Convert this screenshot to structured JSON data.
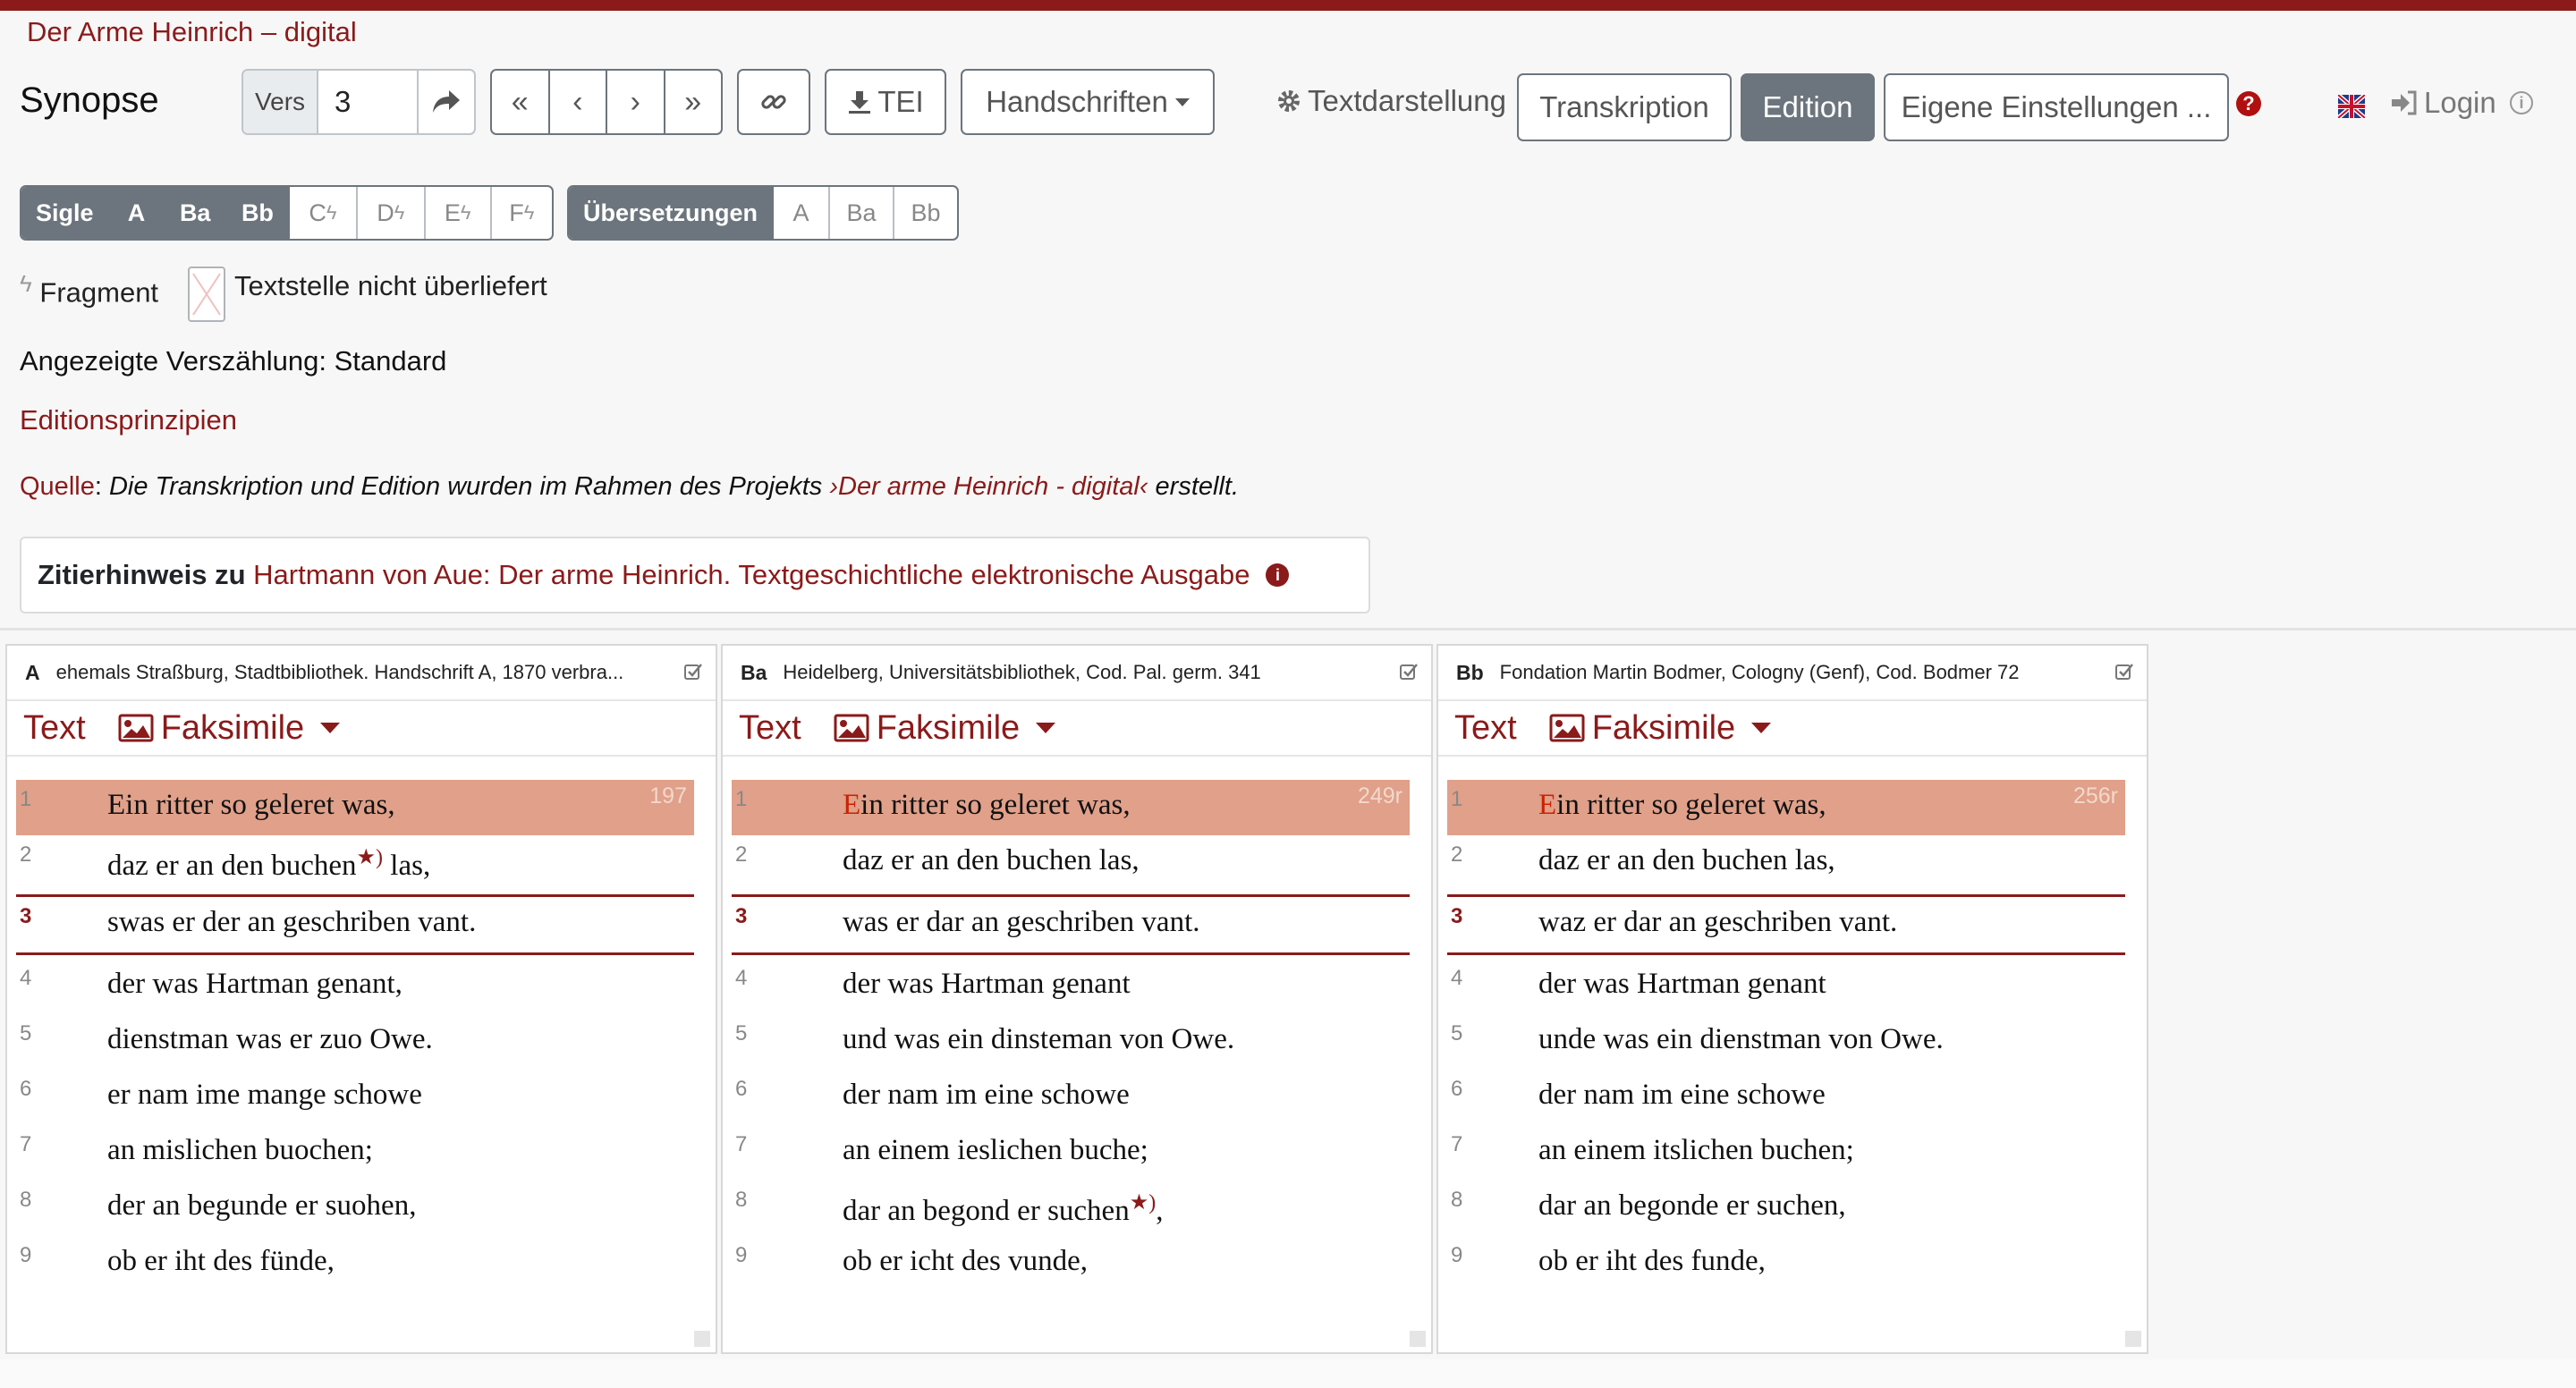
{
  "app": {
    "title": "Der Arme Heinrich – digital"
  },
  "toolbar": {
    "synopse": "Synopse",
    "vers_label": "Vers",
    "vers_value": "3",
    "nav": [
      "«",
      "‹",
      "›",
      "»"
    ],
    "tei": "TEI",
    "handschriften": "Handschriften",
    "textdarstellung": "Textdarstellung",
    "transkription": "Transkription",
    "edition": "Edition",
    "eigene": "Eigene Einstellungen ...",
    "login": "Login"
  },
  "sigle": {
    "label": "Sigle",
    "items": [
      "A",
      "Ba",
      "Bb",
      "C",
      "D",
      "E",
      "F"
    ],
    "uebersetzungen": "Übersetzungen",
    "u_items": [
      "A",
      "Ba",
      "Bb"
    ]
  },
  "legend": {
    "fragment": "Fragment",
    "missing": "Textstelle nicht überliefert"
  },
  "info": {
    "verszaehlung": "Angezeigte Verszählung: Standard",
    "editionsprinzipien": "Editionsprinzipien",
    "quelle_label": "Quelle",
    "quelle_pre": "Die Transkription und Edition wurden im Rahmen des Projekts ",
    "quelle_link": "›Der arme Heinrich - digital‹",
    "quelle_post": " erstellt.",
    "zitier_label": "Zitierhinweis zu ",
    "zitier_link": "Hartmann von Aue: Der arme Heinrich. Textgeschichtliche elektronische Ausgabe"
  },
  "panels": [
    {
      "sigle": "A",
      "title": "ehemals Straßburg, Stadtbibliothek. Handschrift A, 1870 verbra...",
      "tab_text": "Text",
      "tab_faksimile": "Faksimile",
      "folio": "197",
      "verses": [
        {
          "n": "1",
          "initial": "E",
          "rest": "in ritter so geleret was,"
        },
        {
          "n": "2",
          "initial": "",
          "rest": "daz er an den buchen",
          "star": "★)",
          "after": " las,"
        },
        {
          "n": "3",
          "initial": "",
          "rest": "swas er der an geschriben vant."
        },
        {
          "n": "4",
          "initial": "",
          "rest": "der was Hartman genant,"
        },
        {
          "n": "5",
          "initial": "",
          "rest": "dienstman was er zuo Owe."
        },
        {
          "n": "6",
          "initial": "",
          "rest": "er nam ime mange schowe"
        },
        {
          "n": "7",
          "initial": "",
          "rest": "an mislichen buochen;"
        },
        {
          "n": "8",
          "initial": "",
          "rest": "der an begunde er suohen,"
        },
        {
          "n": "9",
          "initial": "",
          "rest": "ob er iht des fünde,"
        }
      ]
    },
    {
      "sigle": "Ba",
      "title": "Heidelberg, Universitätsbibliothek, Cod. Pal. germ. 341",
      "tab_text": "Text",
      "tab_faksimile": "Faksimile",
      "folio": "249r",
      "verses": [
        {
          "n": "1",
          "initial": "E",
          "rest": "in ritter so geleret was,"
        },
        {
          "n": "2",
          "initial": "",
          "rest": "daz er an den buchen las,"
        },
        {
          "n": "3",
          "initial": "",
          "rest": "was er dar an geschriben vant."
        },
        {
          "n": "4",
          "initial": "",
          "rest": "der was Hartman genant"
        },
        {
          "n": "5",
          "initial": "",
          "rest": "und was ein dinsteman von Owe."
        },
        {
          "n": "6",
          "initial": "",
          "rest": "der nam im eine schowe"
        },
        {
          "n": "7",
          "initial": "",
          "rest": "an einem ieslichen buche;"
        },
        {
          "n": "8",
          "initial": "",
          "rest": "dar an begond er suchen",
          "star": "★)",
          "after": ","
        },
        {
          "n": "9",
          "initial": "",
          "rest": "ob er icht des vunde,"
        }
      ]
    },
    {
      "sigle": "Bb",
      "title": "Fondation Martin Bodmer, Cologny (Genf), Cod. Bodmer 72",
      "tab_text": "Text",
      "tab_faksimile": "Faksimile",
      "folio": "256r",
      "verses": [
        {
          "n": "1",
          "initial": "E",
          "rest": "in ritter so geleret was,"
        },
        {
          "n": "2",
          "initial": "",
          "rest": "daz er an den buchen las,"
        },
        {
          "n": "3",
          "initial": "",
          "rest": "waz er dar an geschriben vant."
        },
        {
          "n": "4",
          "initial": "",
          "rest": "der was Hartman genant"
        },
        {
          "n": "5",
          "initial": "",
          "rest": "unde was ein dienstman von Owe."
        },
        {
          "n": "6",
          "initial": "",
          "rest": "der nam im eine schowe"
        },
        {
          "n": "7",
          "initial": "",
          "rest": "an einem itslichen buchen;"
        },
        {
          "n": "8",
          "initial": "",
          "rest": "dar an begonde er suchen,"
        },
        {
          "n": "9",
          "initial": "",
          "rest": "ob er iht des funde,"
        }
      ]
    }
  ],
  "colors": {
    "accent": "#8b1a1a",
    "highlight": "#e0a08a",
    "button": "#6c757d"
  }
}
